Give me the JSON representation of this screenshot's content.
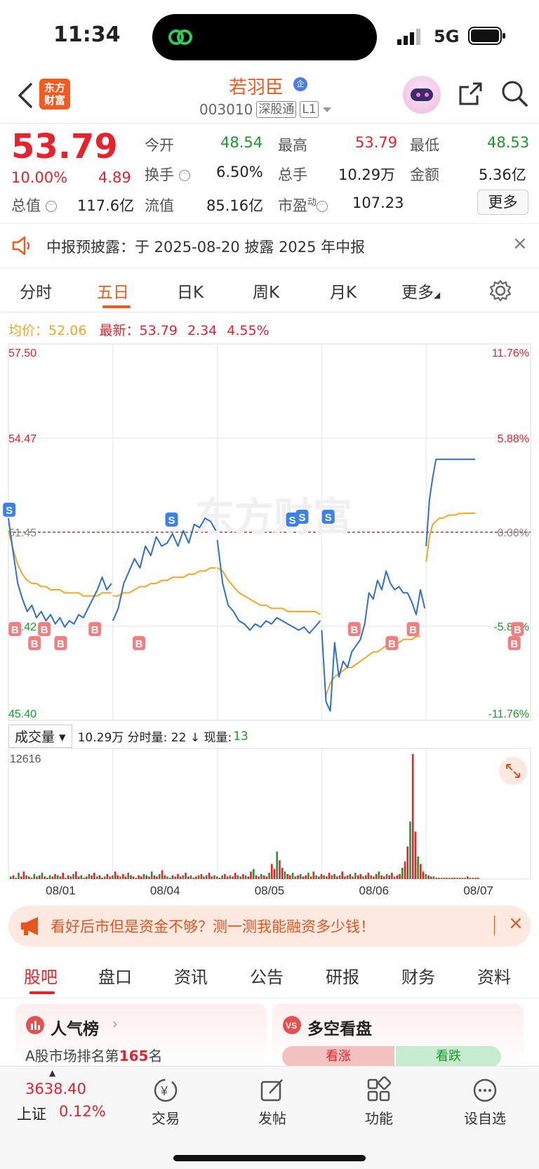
{
  "status_bar": {
    "time": "11:34",
    "network": "5G"
  },
  "header": {
    "logo_text_1": "东方",
    "logo_text_2": "财富",
    "stock_name": "若羽臣",
    "badge": "企",
    "code": "003010",
    "tag1": "深股通",
    "tag2": "L1"
  },
  "quote": {
    "price": "53.79",
    "pct": "10.00%",
    "change": "4.89",
    "open_label": "今开",
    "open": "48.54",
    "high_label": "最高",
    "high": "53.79",
    "low_label": "最低",
    "low": "48.53",
    "turnover_label": "换手",
    "turnover": "6.50%",
    "volume_label": "总手",
    "volume": "10.29万",
    "amount_label": "金额",
    "amount": "5.36亿",
    "mktcap_label": "总值",
    "mktcap": "117.6亿",
    "float_label": "流值",
    "float": "85.16亿",
    "pe_label": "市盈",
    "pe_sup": "动",
    "pe": "107.23",
    "more": "更多"
  },
  "notice": {
    "text": "中报预披露：于 2025-08-20 披露 2025 年中报",
    "close": "×"
  },
  "tabs": [
    "分时",
    "五日",
    "日K",
    "周K",
    "月K",
    "更多"
  ],
  "avg": {
    "avg_label": "均价：",
    "avg": "52.06",
    "latest_label": "最新：",
    "latest": "53.79",
    "chg": "2.34",
    "pct": "4.55%"
  },
  "chart_data": {
    "type": "line",
    "y_left_ticks": [
      "57.50",
      "54.47",
      "51.45",
      "48.42",
      "45.40"
    ],
    "y_right_ticks": [
      "11.76%",
      "5.88%",
      "0.00%",
      "-5.88%",
      "-11.76%"
    ],
    "ylim": [
      45.4,
      57.5
    ],
    "prev_close": 51.45,
    "days": [
      "08/01",
      "08/04",
      "08/05",
      "08/06",
      "08/07"
    ],
    "watermark": "东方财富",
    "series": [
      {
        "values": [
          51.9,
          50.8,
          49.8,
          49.3,
          48.9,
          49.1,
          48.7,
          48.9,
          48.6,
          48.8,
          48.5,
          48.7,
          48.4,
          48.6,
          48.5,
          48.8,
          48.7,
          49.0,
          49.3,
          49.6,
          50.0,
          49.6,
          49.8,
          48.6,
          49.0,
          49.8,
          50.2,
          50.6,
          50.3,
          51.0,
          50.7,
          51.3,
          51.0,
          51.1,
          51.4,
          51.0,
          51.5,
          51.1,
          51.7,
          51.6,
          51.9,
          51.8,
          51.5,
          51.2,
          49.8,
          49.1,
          48.9,
          48.6,
          48.5,
          48.3,
          48.5,
          48.4,
          48.6,
          48.5,
          48.7,
          48.6,
          48.5,
          48.4,
          48.3,
          48.4,
          48.2,
          48.4,
          48.6,
          48.3,
          46.0,
          45.7,
          47.9,
          46.8,
          47.3,
          47.1,
          47.6,
          47.8,
          48.0,
          48.5,
          49.5,
          49.3,
          49.9,
          49.6,
          50.2,
          49.8,
          49.6,
          49.7,
          49.5,
          49.5,
          49.2,
          48.8,
          49.6,
          49.0,
          51.0,
          52.5,
          53.2,
          53.79,
          53.79,
          53.79,
          53.79,
          53.79,
          53.79,
          53.79,
          53.79,
          53.79,
          53.79,
          53.79,
          53.79,
          53.79
        ]
      },
      {
        "values": [
          51.5,
          50.9,
          50.4,
          50.1,
          49.9,
          49.8,
          49.8,
          49.7,
          49.7,
          49.6,
          49.6,
          49.6,
          49.5,
          49.5,
          49.5,
          49.5,
          49.4,
          49.4,
          49.4,
          49.4,
          49.5,
          49.5,
          49.5,
          49.4,
          49.4,
          49.5,
          49.5,
          49.6,
          49.7,
          49.7,
          49.8,
          49.8,
          49.9,
          49.9,
          50.0,
          50.0,
          50.0,
          50.1,
          50.1,
          50.2,
          50.2,
          50.3,
          50.3,
          50.3,
          50.2,
          49.9,
          49.7,
          49.5,
          49.4,
          49.3,
          49.2,
          49.1,
          49.1,
          49.0,
          49.0,
          49.0,
          48.9,
          48.9,
          48.9,
          48.9,
          48.9,
          48.9,
          48.8,
          null,
          46.2,
          46.6,
          46.8,
          46.9,
          47.0,
          47.1,
          47.1,
          47.2,
          47.3,
          47.4,
          47.5,
          47.6,
          47.6,
          47.7,
          47.8,
          47.8,
          47.9,
          47.9,
          48.0,
          48.0,
          48.0,
          48.1,
          48.1,
          null,
          50.5,
          51.3,
          51.7,
          51.8,
          51.9,
          51.9,
          51.95,
          52.0,
          52.0,
          52.0,
          52.05,
          52.05,
          52.06,
          52.06,
          52.06,
          52.06
        ]
      }
    ],
    "trade_markers": [
      {
        "label": "S",
        "x": 0.05
      },
      {
        "label": "B",
        "x": 0.4
      },
      {
        "label": "B",
        "x": 1.6
      },
      {
        "label": "B",
        "x": 2.2
      },
      {
        "label": "B",
        "x": 3.2
      },
      {
        "label": "B",
        "x": 5.3
      },
      {
        "label": "B",
        "x": 8.0
      },
      {
        "label": "S",
        "x": 10.0
      },
      {
        "label": "S",
        "x": 17.4
      },
      {
        "label": "S",
        "x": 18.0
      },
      {
        "label": "S",
        "x": 19.6
      },
      {
        "label": "B",
        "x": 21.2
      },
      {
        "label": "B",
        "x": 23.5
      },
      {
        "label": "B",
        "x": 24.8
      },
      {
        "label": "B",
        "x": 31.0
      },
      {
        "label": "B",
        "x": 31.2
      }
    ]
  },
  "volume": {
    "selector": "成交量",
    "info": "10.29万 分时量: 22 ↓ 现量:",
    "now": "13",
    "max_label": "12616",
    "bars": [
      2,
      3,
      1,
      5,
      2,
      6,
      3,
      2,
      1,
      4,
      2,
      3,
      5,
      2,
      1,
      3,
      2,
      4,
      3,
      2,
      5,
      1,
      3,
      2,
      4,
      6,
      2,
      3,
      1,
      2,
      4,
      3,
      5,
      2,
      3,
      1,
      2,
      4,
      2,
      3,
      6,
      3,
      2,
      4,
      2,
      5,
      3,
      2,
      1,
      3,
      2,
      4,
      3,
      2,
      6,
      3,
      2,
      4,
      7,
      3,
      2,
      1,
      3,
      2,
      4,
      2,
      3,
      5,
      2,
      3,
      1,
      2,
      3,
      4,
      2,
      3,
      5,
      2,
      3,
      2,
      1,
      3,
      4,
      2,
      3,
      2,
      5,
      3,
      2,
      4,
      3,
      2,
      6,
      8,
      3,
      2,
      4,
      3,
      2,
      5,
      12,
      8,
      22,
      15,
      9,
      6,
      4,
      3,
      5,
      2,
      3,
      4,
      2,
      3,
      5,
      2,
      6,
      3,
      2,
      4,
      3,
      2,
      5,
      3,
      4,
      2,
      3,
      6,
      2,
      3,
      4,
      2,
      5,
      3,
      4,
      2,
      3,
      5,
      3,
      2,
      4,
      6,
      3,
      2,
      4,
      3,
      5,
      2,
      3,
      4,
      9,
      14,
      26,
      46,
      100,
      38,
      18,
      12,
      6,
      4,
      3,
      2,
      2,
      1,
      1,
      1,
      1,
      1,
      1,
      1,
      1,
      1,
      1,
      1,
      1,
      2,
      1,
      1,
      1,
      1
    ]
  },
  "ad": {
    "text": "看好后市但是资金不够？测一测我能融资多少钱！",
    "close": "×"
  },
  "bottom_tabs": [
    "股吧",
    "盘口",
    "资讯",
    "公告",
    "研报",
    "财务",
    "资料"
  ],
  "cards": {
    "rank_title": "人气榜",
    "rank_sub_1": "A股市场排名第",
    "rank_num": "165",
    "rank_sub_2": "名",
    "vs_title": "多空看盘",
    "vs_up": "看涨",
    "vs_down": "看跌"
  },
  "bottom_bar": {
    "index_value": "3638.40",
    "index_name": "上证",
    "index_pct": "0.12%",
    "items": [
      "交易",
      "发帖",
      "功能",
      "设自选"
    ]
  },
  "colors": {
    "accent": "#f25a1e",
    "up": "#e8212b",
    "down": "#1a9a2a",
    "price_line": "#2f6fcf",
    "avg_line": "#f5a623"
  }
}
